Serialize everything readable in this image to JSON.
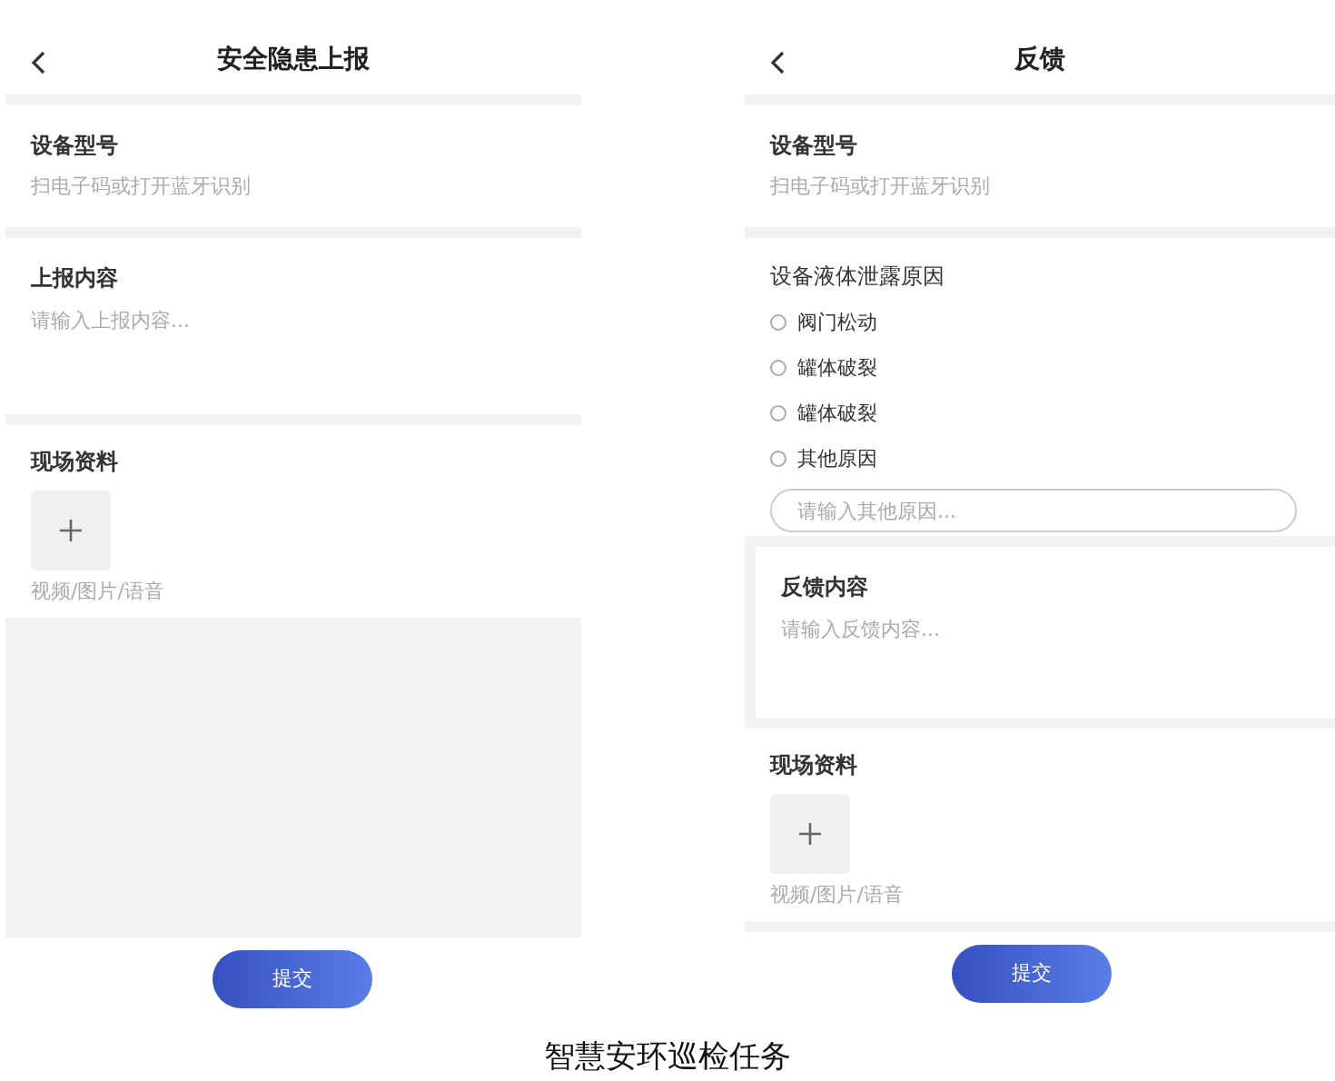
{
  "screens": [
    {
      "title": "安全隐患上报",
      "filler": true,
      "sections": [
        {
          "kind": "field",
          "label": "设备型号",
          "placeholder": "扫电子码或打开蓝牙识别"
        },
        {
          "kind": "textarea",
          "label": "上报内容",
          "placeholder": "请输入上报内容..."
        },
        {
          "kind": "upload",
          "label": "现场资料",
          "hint": "视频/图片/语音"
        }
      ],
      "submit": "提交"
    },
    {
      "title": "反馈",
      "filler": false,
      "sections": [
        {
          "kind": "field",
          "label": "设备型号",
          "placeholder": "扫电子码或打开蓝牙识别"
        },
        {
          "kind": "radio",
          "label": "设备液体泄露原因",
          "options": [
            {
              "label": "阀门松动",
              "selected": false
            },
            {
              "label": "罐体破裂",
              "selected": false
            },
            {
              "label": "罐体破裂",
              "selected": false
            },
            {
              "label": "其他原因",
              "selected": false
            }
          ],
          "placeholder": "请输入其他原因..."
        },
        {
          "kind": "framed",
          "label": "反馈内容",
          "placeholder": "请输入反馈内容..."
        },
        {
          "kind": "upload",
          "label": "现场资料",
          "hint": "视频/图片/语音"
        }
      ],
      "submit": "提交"
    }
  ],
  "caption": "智慧安环巡检任务"
}
